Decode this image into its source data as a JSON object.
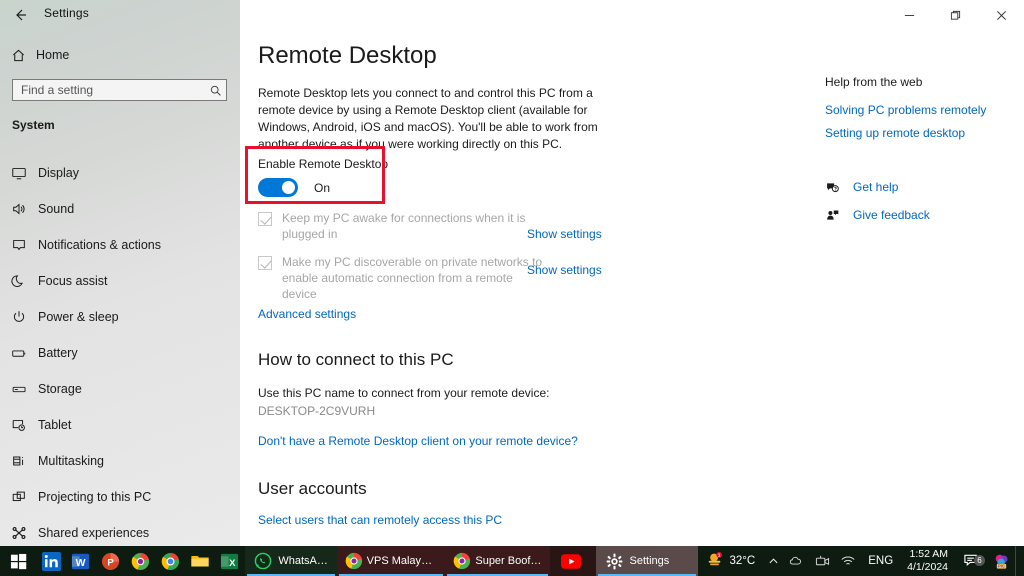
{
  "window": {
    "app_title": "Settings",
    "back_icon": "back-arrow-icon",
    "controls": {
      "minimize": "–",
      "maximize": "❐",
      "close": "✕"
    }
  },
  "sidebar": {
    "home_label": "Home",
    "home_icon": "home-icon",
    "search": {
      "placeholder": "Find a setting",
      "value": "",
      "icon": "search-icon"
    },
    "group_title": "System",
    "items": [
      {
        "label": "Display",
        "icon": "monitor-icon"
      },
      {
        "label": "Sound",
        "icon": "speaker-icon"
      },
      {
        "label": "Notifications & actions",
        "icon": "notification-icon"
      },
      {
        "label": "Focus assist",
        "icon": "moon-icon"
      },
      {
        "label": "Power & sleep",
        "icon": "power-icon"
      },
      {
        "label": "Battery",
        "icon": "battery-icon"
      },
      {
        "label": "Storage",
        "icon": "storage-icon"
      },
      {
        "label": "Tablet",
        "icon": "tablet-icon"
      },
      {
        "label": "Multitasking",
        "icon": "multitasking-icon"
      },
      {
        "label": "Projecting to this PC",
        "icon": "projecting-icon"
      },
      {
        "label": "Shared experiences",
        "icon": "share-icon"
      }
    ]
  },
  "main": {
    "page_title": "Remote Desktop",
    "description": "Remote Desktop lets you connect to and control this PC from a remote device by using a Remote Desktop client (available for Windows, Android, iOS and macOS). You'll be able to work from another device as if you were working directly on this PC.",
    "toggle": {
      "label": "Enable Remote Desktop",
      "state_label": "On",
      "highlight_color": "#e8112d",
      "accent_color": "#0078d7"
    },
    "checkboxes": [
      {
        "text": "Keep my PC awake for connections when it is plugged in",
        "link": "Show settings",
        "checked": true,
        "disabled": true
      },
      {
        "text": "Make my PC discoverable on private networks to enable automatic connection from a remote device",
        "link": "Show settings",
        "checked": true,
        "disabled": true
      }
    ],
    "advanced_settings_link": "Advanced settings",
    "connect_section": {
      "title": "How to connect to this PC",
      "sub_text": "Use this PC name to connect from your remote device:",
      "pc_name": "DESKTOP-2C9VURH",
      "client_link": "Don't have a Remote Desktop client on your remote device?"
    },
    "users_section": {
      "title": "User accounts",
      "link": "Select users that can remotely access this PC"
    }
  },
  "help": {
    "title": "Help from the web",
    "links": [
      "Solving PC problems remotely",
      "Setting up remote desktop"
    ],
    "actions": [
      {
        "label": "Get help",
        "icon": "get-help-icon"
      },
      {
        "label": "Give feedback",
        "icon": "feedback-icon"
      }
    ],
    "link_color": "#0067c0"
  },
  "taskbar": {
    "start_icon": "windows-start-icon",
    "pinned": [
      {
        "name": "linkedin",
        "icon": "linkedin-icon"
      },
      {
        "name": "word",
        "icon": "word-icon"
      },
      {
        "name": "powerpoint",
        "icon": "powerpoint-icon"
      },
      {
        "name": "chrome-beta",
        "icon": "chrome-beta-icon"
      },
      {
        "name": "chrome",
        "icon": "chrome-icon"
      },
      {
        "name": "file-explorer",
        "icon": "folder-icon"
      },
      {
        "name": "excel",
        "icon": "excel-icon"
      }
    ],
    "windows": [
      {
        "label": "WhatsApp",
        "icon": "whatsapp-icon",
        "active": true
      },
      {
        "label": "VPS Malaysia c...",
        "icon": "chrome-beta-icon",
        "active": true
      },
      {
        "label": "Super Boof Str...",
        "icon": "chrome-beta-icon",
        "active": true
      },
      {
        "label": "",
        "icon": "youtube-icon",
        "active": false
      },
      {
        "label": "Settings",
        "icon": "gear-icon",
        "active": true
      }
    ],
    "tray": {
      "weather_temp": "32°C",
      "weather_icon": "weather-sun-icon",
      "chevron_icon": "chevron-up-icon",
      "icons": [
        {
          "name": "onedrive-icon"
        },
        {
          "name": "meet-now-icon"
        },
        {
          "name": "wifi-icon"
        }
      ],
      "language": "ENG",
      "clock_time": "1:52 AM",
      "clock_date": "4/1/2024",
      "notification_icon": "notification-icon",
      "notification_count": "6",
      "app_icon": "pic-app-icon"
    }
  }
}
